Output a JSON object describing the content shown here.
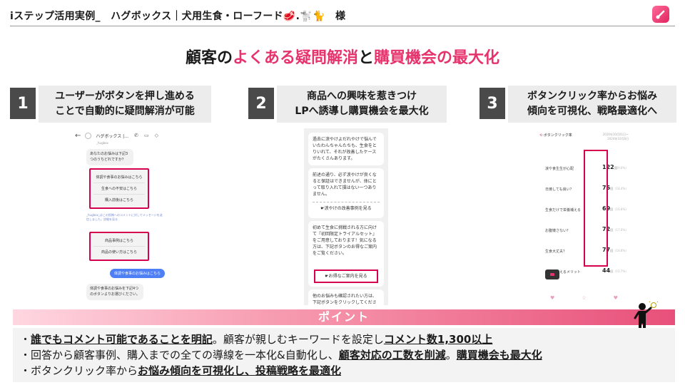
{
  "header": {
    "title": "iステップ活用実例_　ハグボックス｜犬用生食・ローフード🥩.🐩🐈　様",
    "logo_icon": "istep-logo-icon"
  },
  "headline": {
    "part1": "顧客の",
    "part2": "よくある疑問解消",
    "part3": "と",
    "part4": "購買機会の最大化"
  },
  "steps": [
    {
      "num": "1",
      "line1": "ユーザーがボタンを押し進める",
      "line2": "ことで自動的に疑問解消が可能"
    },
    {
      "num": "2",
      "line1": "商品への興味を惹きつけ",
      "line2": "LPへ誘導し購買機会を最大化"
    },
    {
      "num": "3",
      "line1": "ボタンクリック率からお悩み",
      "line2": "傾向を可視化、戦略最適化へ"
    }
  ],
  "phone_a": {
    "account": "ハグボックス |…",
    "handle": "_hugbox",
    "q1": "あなたのお悩みは下記3つのうちどれですか？",
    "opts1": [
      "体調や食事のお悩みはこちら",
      "生食への不安はこちら",
      "購入前後はこちら"
    ],
    "note": "_hugbox_はこの投稿へのコメントに対してメッセージを送信しました。詳細を見る",
    "opts2": [
      "商品事例はこちら",
      "商品の使い方はこちら"
    ],
    "blue": "体調や食事のお悩みはこちら",
    "q2": "体調や食事のお悩みを下記4つのボタンよりお選びください。"
  },
  "phone_b": {
    "msg1": "過去に涙やけよだれやけで悩んでいたわんちゃんたちも、生食をとりいれて、それが改善したケースがたくさんあります。",
    "msg2": "前述の通り、必ず涙やけが良くなると保証はできませんが、体にとって取り入れて損はない一つありません。",
    "link1": "☛涙やけの改善事例を見る",
    "msg3": "初めて生食に挑戦される方に向けて『初回限定トライアルセット』をご用意しております！気になる方は、下記ボタンのお得なご案内をご覧ください。",
    "link2": "☛お得なご案内を見る",
    "msg4": "他のお悩みも確認されたい方は、下記ボタンをクリックしてください。"
  },
  "phone_c": {
    "title": "ボタンクリック率",
    "dates": "2024年10月01日〜 2024年10月6日",
    "rows": [
      {
        "label": "涙や食生生が心配",
        "value": "122",
        "unit": "回",
        "pct": "(29.6%)"
      },
      {
        "label": "日焼しても良い？",
        "value": "75",
        "unit": "回",
        "pct": "(18.4%)"
      },
      {
        "label": "生食だけで栄養補える",
        "value": "69",
        "unit": "回",
        "pct": "(16.8%)"
      },
      {
        "label": "お腹壊さない？",
        "value": "72",
        "unit": "回",
        "pct": "(17.6%)"
      },
      {
        "label": "生食大丈夫？",
        "value": "77",
        "unit": "回",
        "pct": "(18.8%)"
      },
      {
        "label": "生肉をなえるメリット",
        "value": "44",
        "unit": "回",
        "pct": "(10.7%)"
      }
    ]
  },
  "points": {
    "title": "ポイント",
    "p1a": "誰でもコメント可能であることを明記",
    "p1b": "。顧客が親しむキーワードを設定し",
    "p1c": "コメント数1,300以上",
    "p2a": "回答から顧客事例、購入までの全ての導線を一本化&自動化し、",
    "p2b": "顧客対応の工数を削減",
    "p2c": "。",
    "p2d": "購買機会も最大化",
    "p3a": "ボタンクリック率から",
    "p3b": "お悩み傾向を可視化し、投稿戦略を最適化"
  },
  "colors": {
    "accent": "#e6336e",
    "highlight_frame": "#d6004f",
    "step_num_bg": "#4a4a4a",
    "step_box_bg": "#ececec"
  }
}
